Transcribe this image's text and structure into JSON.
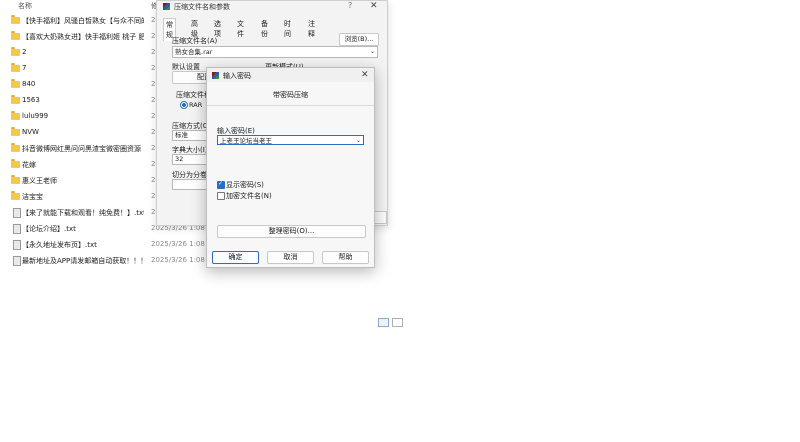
{
  "explorer": {
    "col_name": "名称",
    "col_date": "修",
    "rows": [
      {
        "type": "folder",
        "name": "【快手福利】风骚白皙熟女【与众不同的...",
        "date": "20"
      },
      {
        "type": "folder",
        "name": "【喜欢大奶熟女进】快手福利姬 桃子 肥...",
        "date": "20"
      },
      {
        "type": "folder",
        "name": "2",
        "date": "20"
      },
      {
        "type": "folder",
        "name": "7",
        "date": "20"
      },
      {
        "type": "folder",
        "name": "840",
        "date": "20"
      },
      {
        "type": "folder",
        "name": "1563",
        "date": "20"
      },
      {
        "type": "folder",
        "name": "lulu999",
        "date": "20"
      },
      {
        "type": "folder",
        "name": "NVW",
        "date": "20"
      },
      {
        "type": "folder",
        "name": "抖音微博网红黑问问黑渣宝微密圈资源 ...",
        "date": "20"
      },
      {
        "type": "folder",
        "name": "花嫁",
        "date": "20"
      },
      {
        "type": "folder",
        "name": "惠义王老师",
        "date": "20"
      },
      {
        "type": "folder",
        "name": "洁宝宝",
        "date": "20"
      },
      {
        "type": "txt",
        "name": "【来了就能下载和观看！纯免费！】.txt",
        "date": "20"
      },
      {
        "type": "txt",
        "name": "【论坛介绍】.txt",
        "date": "2025/3/26 1:08"
      },
      {
        "type": "txt",
        "name": "【永久地址发布页】.txt",
        "date": "2025/3/26 1:08"
      },
      {
        "type": "txt",
        "name": "最新地址及APP请发邮箱自动获取！！！...",
        "date": "2025/3/26 1:08"
      }
    ]
  },
  "archive_dialog": {
    "title": "压缩文件名和参数",
    "help": "?",
    "close": "✕",
    "tabs": [
      "常规",
      "高级",
      "选项",
      "文件",
      "备份",
      "时间",
      "注释"
    ],
    "name_label": "压缩文件名(A)",
    "browse_label": "浏览(B)...",
    "name_value": "熟女合集.rar",
    "defaults_label": "默认设置",
    "update_mode_label": "更新模式(U)",
    "profiles_button": "配置",
    "format_label": "压缩文件格",
    "format_rar": "RAR",
    "method_label": "压缩方式(C)",
    "method_value": "标准",
    "dict_label": "字典大小(I)",
    "dict_value": "32",
    "split_label": "切分为分卷("
  },
  "password_dialog": {
    "title": "输入密码",
    "close": "✕",
    "heading": "带密码压缩",
    "password_label": "输入密码(E)",
    "password_value": "上老王论坛当老王",
    "show_password_label": "显示密码(S)",
    "show_password_checked": true,
    "encrypt_names_label": "加密文件名(N)",
    "encrypt_names_checked": false,
    "organize_button": "整理密码(O)...",
    "ok_button": "确定",
    "cancel_button": "取消",
    "help_button": "帮助"
  },
  "colors": {
    "accent": "#2b6cc4",
    "folder": "#f2c94c"
  }
}
